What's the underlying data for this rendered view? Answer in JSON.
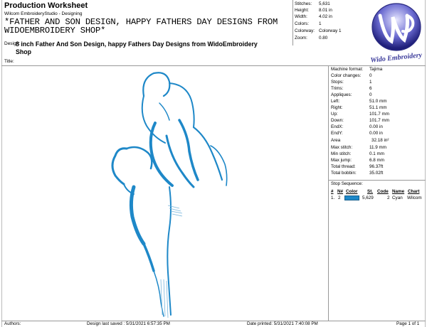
{
  "header": {
    "title": "Production Worksheet",
    "subtitle": "Wilcom EmbroideryStudio - Designing",
    "design_big": "*FATHER AND SON DESIGN, HAPPY FATHERS DAY DESIGNS FROM WIDOEMBROIDERY SHOP*",
    "design_label": "Design:",
    "design_text": "8 inch Father And Son Design, happy Fathers Day Designs from WidoEmbroidery Shop",
    "title_label": "Title:"
  },
  "stats": [
    {
      "k": "Stitches:",
      "v": "5,631"
    },
    {
      "k": "Height:",
      "v": "8.01 in"
    },
    {
      "k": "Width:",
      "v": "4.02 in"
    },
    {
      "k": "Colors:",
      "v": "1"
    },
    {
      "k": "Colorway:",
      "v": "Colorway 1"
    },
    {
      "k": "Zoom:",
      "v": "0.80"
    }
  ],
  "logo": {
    "text": "Wido Embroidery",
    "brand_color": "#3a3a9a"
  },
  "info": [
    {
      "k": "Machine format:",
      "v": "Tajima"
    },
    {
      "k": "Color changes:",
      "v": "0"
    },
    {
      "k": "Stops:",
      "v": "1"
    },
    {
      "k": "Trims:",
      "v": "6"
    },
    {
      "k": "Appliques:",
      "v": "0"
    },
    {
      "k": "Left:",
      "v": "51.0 mm"
    },
    {
      "k": "Right:",
      "v": "51.1 mm"
    },
    {
      "k": "Up:",
      "v": "101.7 mm"
    },
    {
      "k": "Down:",
      "v": "101.7 mm"
    },
    {
      "k": "EndX:",
      "v": "0.00 in"
    },
    {
      "k": "EndY:",
      "v": "0.00 in"
    },
    {
      "k": "Area",
      "v": "32.18 in²"
    },
    {
      "k": "Max stitch:",
      "v": "11.9 mm"
    },
    {
      "k": "Min stitch:",
      "v": "0.1 mm"
    },
    {
      "k": "Max jump:",
      "v": "6.8 mm"
    },
    {
      "k": "Total thread:",
      "v": "96.37ft"
    },
    {
      "k": "Total bobbin:",
      "v": "35.02ft"
    }
  ],
  "stop_sequence": {
    "title": "Stop Sequence:",
    "headers": [
      "#",
      "N#",
      "Color",
      "St.",
      "Code",
      "Name",
      "Chart"
    ],
    "row": {
      "num": "1.",
      "n": "2",
      "stitches": "5,629",
      "code": "2",
      "name": "Cyan",
      "chart": "Wilcom",
      "color": "#1e88c8"
    }
  },
  "footer": {
    "authors": "Authors:",
    "saved": "Design last saved : 5/31/2021 6:57:35 PM",
    "printed": "Date printed: 5/31/2021 7:40:08 PM",
    "page": "Page 1 of 1"
  }
}
